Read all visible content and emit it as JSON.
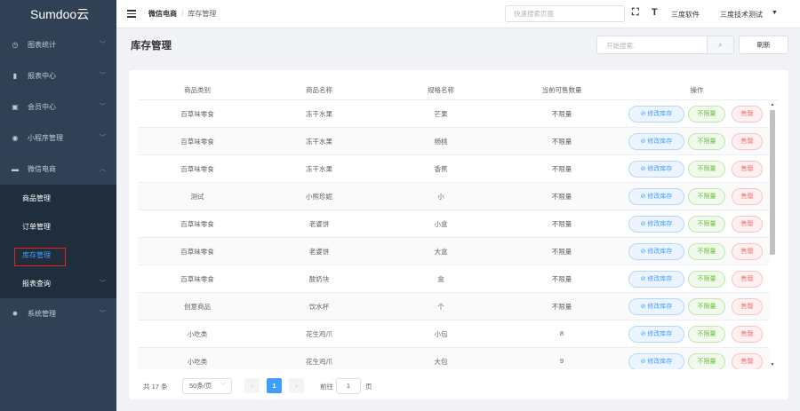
{
  "app": {
    "logo": "Sumdoo云"
  },
  "sidebar": {
    "items": [
      {
        "label": "图表统计",
        "icon": "gauge-icon",
        "glyph": "◷"
      },
      {
        "label": "报表中心",
        "icon": "bar-chart-icon",
        "glyph": "▮"
      },
      {
        "label": "会员中心",
        "icon": "id-card-icon",
        "glyph": "▣"
      },
      {
        "label": "小程序管理",
        "icon": "aperture-icon",
        "glyph": "◉"
      },
      {
        "label": "微信电商",
        "icon": "shop-icon",
        "glyph": "▬"
      }
    ],
    "submenu": [
      {
        "label": "商品管理"
      },
      {
        "label": "订单管理"
      },
      {
        "label": "库存管理"
      },
      {
        "label": "报表查询"
      }
    ],
    "bottom_item": {
      "label": "系统管理",
      "icon": "gear-icon",
      "glyph": "✸"
    }
  },
  "header": {
    "breadcrumb": [
      "微信电商",
      "库存管理"
    ],
    "breadcrumb_sep": "/",
    "search_placeholder": "快速搜索页面",
    "fullscreen_glyph": "⛶",
    "fontsize_glyph": "T",
    "company": "三度软件",
    "user": "三度技术测试",
    "user_caret": "▼"
  },
  "page": {
    "title": "库存管理",
    "search_placeholder": "开始搜索.",
    "search_button_glyph": "⌕",
    "refresh_label": "刷新"
  },
  "table": {
    "columns": [
      "商品类别",
      "商品名称",
      "规格名称",
      "当前可售数量",
      "操作"
    ],
    "actions": {
      "edit": "⊘ 修改库存",
      "unlimited": "不限量",
      "soldout": "售罄"
    },
    "rows": [
      {
        "category": "百草味零食",
        "name": "冻干水果",
        "spec": "芒果",
        "qty": "不限量"
      },
      {
        "category": "百草味零食",
        "name": "冻干水果",
        "spec": "杨桃",
        "qty": "不限量"
      },
      {
        "category": "百草味零食",
        "name": "冻干水果",
        "spec": "香蕉",
        "qty": "不限量"
      },
      {
        "category": "测试",
        "name": "小熊珍妮",
        "spec": "小",
        "qty": "不限量"
      },
      {
        "category": "百草味零食",
        "name": "老婆饼",
        "spec": "小盒",
        "qty": "不限量"
      },
      {
        "category": "百草味零食",
        "name": "老婆饼",
        "spec": "大盒",
        "qty": "不限量"
      },
      {
        "category": "百草味零食",
        "name": "酸奶块",
        "spec": "盒",
        "qty": "不限量"
      },
      {
        "category": "创意商品",
        "name": "饮水杯",
        "spec": "个",
        "qty": "不限量"
      },
      {
        "category": "小吃类",
        "name": "花生鸡爪",
        "spec": "小包",
        "qty": "8"
      },
      {
        "category": "小吃类",
        "name": "花生鸡爪",
        "spec": "大包",
        "qty": "9"
      }
    ]
  },
  "pagination": {
    "total": "共 17 条",
    "page_size": "50条/页",
    "current_page": "1",
    "goto_prefix": "前往",
    "goto_value": "1",
    "goto_suffix": "页",
    "prev_glyph": "‹",
    "next_glyph": "›"
  },
  "colors": {
    "sidebar": "#304156",
    "submenu": "#1f2d3d",
    "accent": "#409eff",
    "highlight": "#e5231f"
  }
}
